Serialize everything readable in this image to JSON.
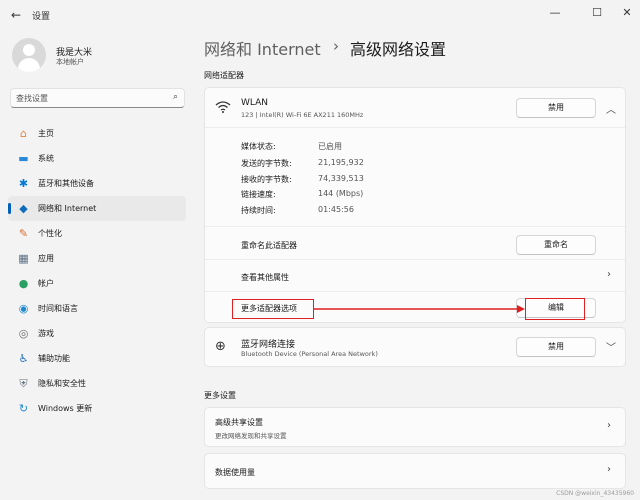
{
  "window": {
    "title": "设置",
    "back_icon": "←",
    "minimize_icon": "—",
    "maximize_icon": "☐",
    "close_icon": "✕"
  },
  "user": {
    "name": "我是大米",
    "account_type": "本地帐户"
  },
  "search": {
    "placeholder": "查找设置",
    "icon": "⌕"
  },
  "sidebar": {
    "items": [
      {
        "label": "主页",
        "icon": "⌂",
        "icon_name": "home-icon",
        "color": "#e9833d",
        "active": false
      },
      {
        "label": "系统",
        "icon": "▬",
        "icon_name": "monitor-icon",
        "color": "#2b88d8",
        "active": false
      },
      {
        "label": "蓝牙和其他设备",
        "icon": "✱",
        "icon_name": "bluetooth-icon",
        "color": "#0078d4",
        "active": false
      },
      {
        "label": "网络和 Internet",
        "icon": "◆",
        "icon_name": "wifi-icon",
        "color": "#0f6cbd",
        "active": true
      },
      {
        "label": "个性化",
        "icon": "✎",
        "icon_name": "brush-icon",
        "color": "#d86b2d",
        "active": false
      },
      {
        "label": "应用",
        "icon": "▦",
        "icon_name": "apps-icon",
        "color": "#5b6d80",
        "active": false
      },
      {
        "label": "帐户",
        "icon": "●",
        "icon_name": "account-icon",
        "color": "#2aa162",
        "active": false
      },
      {
        "label": "时间和语言",
        "icon": "◉",
        "icon_name": "globe-clock-icon",
        "color": "#1f8ad2",
        "active": false
      },
      {
        "label": "游戏",
        "icon": "◎",
        "icon_name": "gamepad-icon",
        "color": "#6b6b6b",
        "active": false
      },
      {
        "label": "辅助功能",
        "icon": "♿",
        "icon_name": "accessibility-icon",
        "color": "#1c6fc0",
        "active": false
      },
      {
        "label": "隐私和安全性",
        "icon": "⛨",
        "icon_name": "shield-icon",
        "color": "#6b7683",
        "active": false
      },
      {
        "label": "Windows 更新",
        "icon": "↻",
        "icon_name": "windows-update-icon",
        "color": "#1f8ad2",
        "active": false
      }
    ]
  },
  "breadcrumb": {
    "parent": "网络和 Internet",
    "separator": "›",
    "current": "高级网络设置"
  },
  "adapters_section": "网络适配器",
  "wlan": {
    "name": "WLAN",
    "description": "123 | Intel(R) Wi-Fi 6E AX211 160MHz",
    "disable_button": "禁用",
    "props": [
      {
        "key": "媒体状态:",
        "value": "已启用"
      },
      {
        "key": "发送的字节数:",
        "value": "21,195,932"
      },
      {
        "key": "接收的字节数:",
        "value": "74,339,513"
      },
      {
        "key": "链接速度:",
        "value": "144 (Mbps)"
      },
      {
        "key": "持续时间:",
        "value": "01:45:56"
      }
    ],
    "rename_label": "重命名此适配器",
    "rename_button": "重命名",
    "view_props_label": "查看其他属性",
    "more_options_label": "更多适配器选项",
    "edit_button": "编辑"
  },
  "bluetooth": {
    "name": "蓝牙网络连接",
    "description": "Bluetooth Device (Personal Area Network)",
    "disable_button": "禁用"
  },
  "more_section": "更多设置",
  "sharing": {
    "title": "高级共享设置",
    "subtitle": "更改网络发现和共享设置"
  },
  "data_usage": {
    "title": "数据使用量"
  },
  "watermark": "CSDN @weixin_43435960",
  "colors": {
    "accent": "#005fb8",
    "highlight": "#e02020"
  }
}
